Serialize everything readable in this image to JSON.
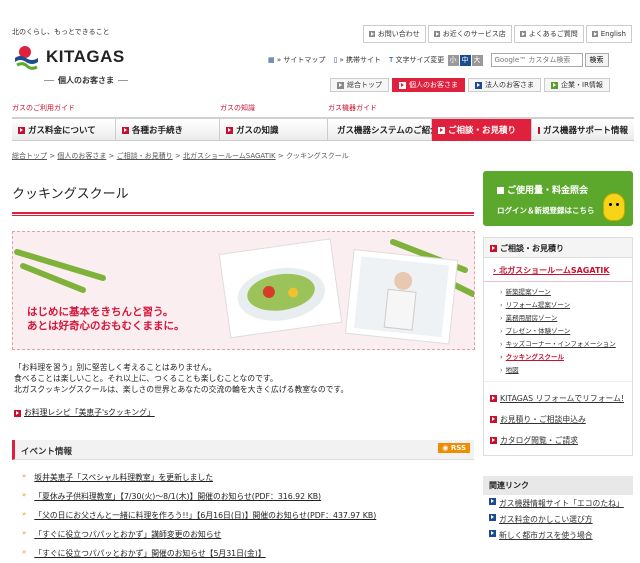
{
  "header": {
    "tagline": "北のくらし、もっとできること",
    "logo_text": "KITAGAS",
    "logo_sub": "個人のお客さま",
    "top_links": [
      "お問い合わせ",
      "お近くのサービス店",
      "よくあるご質問",
      "English"
    ],
    "util": {
      "sitemap": "サイトマップ",
      "mobile": "携帯サイト",
      "font_size_label": "文字サイズ変更",
      "sizes": [
        "小",
        "中",
        "大"
      ],
      "search_placeholder": "Google™ カスタム検索",
      "search_button": "検索"
    },
    "segments": [
      "総合トップ",
      "個人のお客さま",
      "法人のお客さま",
      "企業・IR情報"
    ]
  },
  "nav": {
    "categories": [
      "ガスのご利用ガイド",
      "ガスの知識",
      "ガス機器ガイド"
    ],
    "items": [
      "ガス料金について",
      "各種お手続き",
      "ガスの知識",
      "ガス機器システムのご紹介",
      "ご相談・お見積り",
      "ガス機器サポート情報"
    ]
  },
  "breadcrumb": [
    "総合トップ",
    "個人のお客さま",
    "ご相談・お見積り",
    "北ガスショールームSAGATIK",
    "クッキングスクール"
  ],
  "main": {
    "title": "クッキングスクール",
    "hero_copy_1": "はじめに基本をきちんと習う。",
    "hero_copy_2": "あとは好奇心のおもむくままに。",
    "intro_1": "「お料理を習う」別に堅苦しく考えることはありません。",
    "intro_2": "食べることは楽しいこと。それ以上に、つくることも楽しむことなのです。",
    "intro_3": "北ガスクッキングスクールは、楽しさの世界とあなたの交流の輪を大きく広げる教室なのです。",
    "recipe_link": "お料理レシピ「美恵子'sクッキング」",
    "events_title": "イベント情報",
    "rss": "RSS",
    "events": [
      "坂井美恵子「スペシャル料理教室」を更新しました",
      "「夏休み子供料理教室」【7/30(火)～8/1(木)】開催のお知らせ(PDF：316.92 KB)",
      "「父の日にお父さんと一緒に料理を作ろう!!」【6月16日(日)】開催のお知らせ(PDF：437.97 KB)",
      "「すぐに役立つパパッとおかず」講師変更のお知らせ",
      "「すぐに役立つパパッとおかず」開催のお知らせ【5月31日(金)】"
    ]
  },
  "sidebar": {
    "usage_title": "ご使用量・料金照会",
    "usage_sub": "ログイン＆新規登録はこちら",
    "section_title": "ご相談・お見積り",
    "current": "北ガスショールームSAGATIK",
    "subs": [
      "新築提案ゾーン",
      "リフォーム提案ゾーン",
      "業務用厨房ゾーン",
      "プレゼン・体験ゾーン",
      "キッズコーナー・インフォメーション",
      "クッキングスクール",
      "地図"
    ],
    "links": [
      "KITAGAS リフォームでリフォーム!",
      "お見積り・ご相談申込み",
      "カタログ閲覧・ご請求"
    ],
    "related_title": "関連リンク",
    "related": [
      "ガス機器情報サイト「エコのたね」",
      "ガス料金のかしこい選び方",
      "新しく都市ガスを使う場合"
    ]
  },
  "colors": {
    "accent": "#e0213e",
    "green": "#5ca82d",
    "orange": "#f08c00",
    "navy": "#1a4c8f"
  }
}
